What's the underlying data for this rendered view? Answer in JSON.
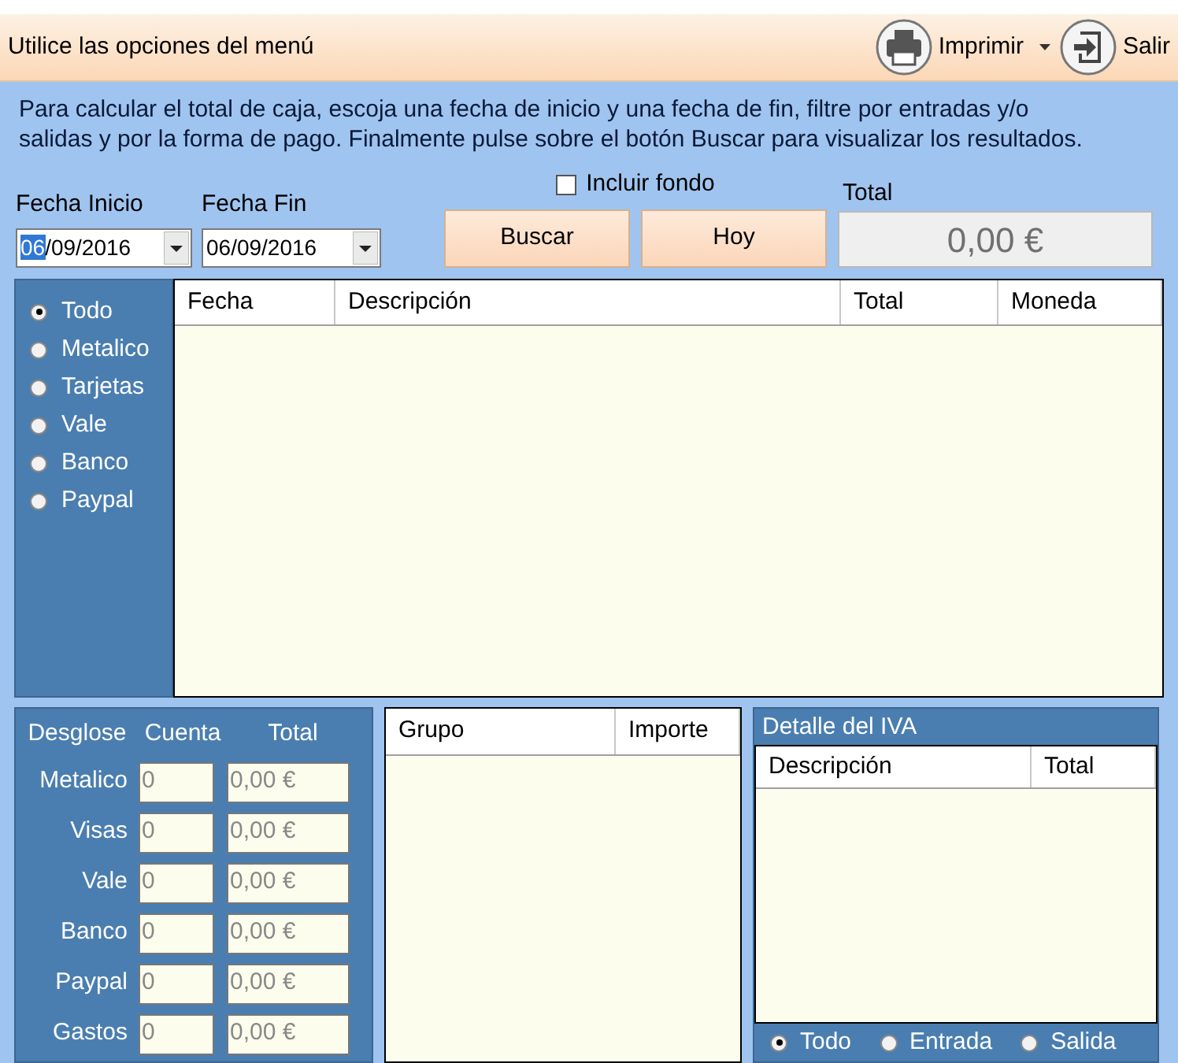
{
  "toolbar": {
    "hint": "Utilice las opciones del menú",
    "buttons": [
      {
        "kind": "print",
        "label": "Imprimir",
        "dropdown": true
      },
      {
        "kind": "exit",
        "label": "Salir",
        "dropdown": false
      }
    ]
  },
  "instructions": "Para calcular el total de caja, escoja una fecha de inicio y una fecha de fin, filtre por entradas y/o salidas y por la forma de pago. Finalmente pulse sobre el botón Buscar para visualizar los resultados.",
  "dates": [
    {
      "label": "Fecha Inicio",
      "segments": [
        {
          "text": "06",
          "selected": true
        },
        {
          "text": "/09/2016",
          "selected": false
        }
      ]
    },
    {
      "label": "Fecha Fin",
      "segments": [
        {
          "text": "06/09/2016",
          "selected": false
        }
      ]
    }
  ],
  "include_fund": {
    "label": "Incluir fondo",
    "checked": false
  },
  "actions": [
    "Buscar",
    "Hoy"
  ],
  "total": {
    "label": "Total",
    "value": "0,00 €"
  },
  "payment_filter": [
    {
      "label": "Todo",
      "selected": true
    },
    {
      "label": "Metalico",
      "selected": false
    },
    {
      "label": "Tarjetas",
      "selected": false
    },
    {
      "label": "Vale",
      "selected": false
    },
    {
      "label": "Banco",
      "selected": false
    },
    {
      "label": "Paypal",
      "selected": false
    }
  ],
  "movements_table": {
    "columns": [
      "Fecha",
      "Descripción",
      "Total",
      "Moneda"
    ]
  },
  "breakdown": {
    "headers": [
      "Desglose",
      "Cuenta",
      "Total"
    ],
    "rows": [
      {
        "label": "Metalico",
        "count": "0",
        "total": "0,00 €"
      },
      {
        "label": "Visas",
        "count": "0",
        "total": "0,00 €"
      },
      {
        "label": "Vale",
        "count": "0",
        "total": "0,00 €"
      },
      {
        "label": "Banco",
        "count": "0",
        "total": "0,00 €"
      },
      {
        "label": "Paypal",
        "count": "0",
        "total": "0,00 €"
      },
      {
        "label": "Gastos",
        "count": "0",
        "total": "0,00 €"
      }
    ]
  },
  "group_table": {
    "columns": [
      "Grupo",
      "Importe"
    ]
  },
  "vat_detail": {
    "title": "Detalle del IVA",
    "columns": [
      "Descripción",
      "Total"
    ],
    "filter": [
      {
        "label": "Todo",
        "selected": true
      },
      {
        "label": "Entrada",
        "selected": false
      },
      {
        "label": "Salida",
        "selected": false
      }
    ]
  }
}
